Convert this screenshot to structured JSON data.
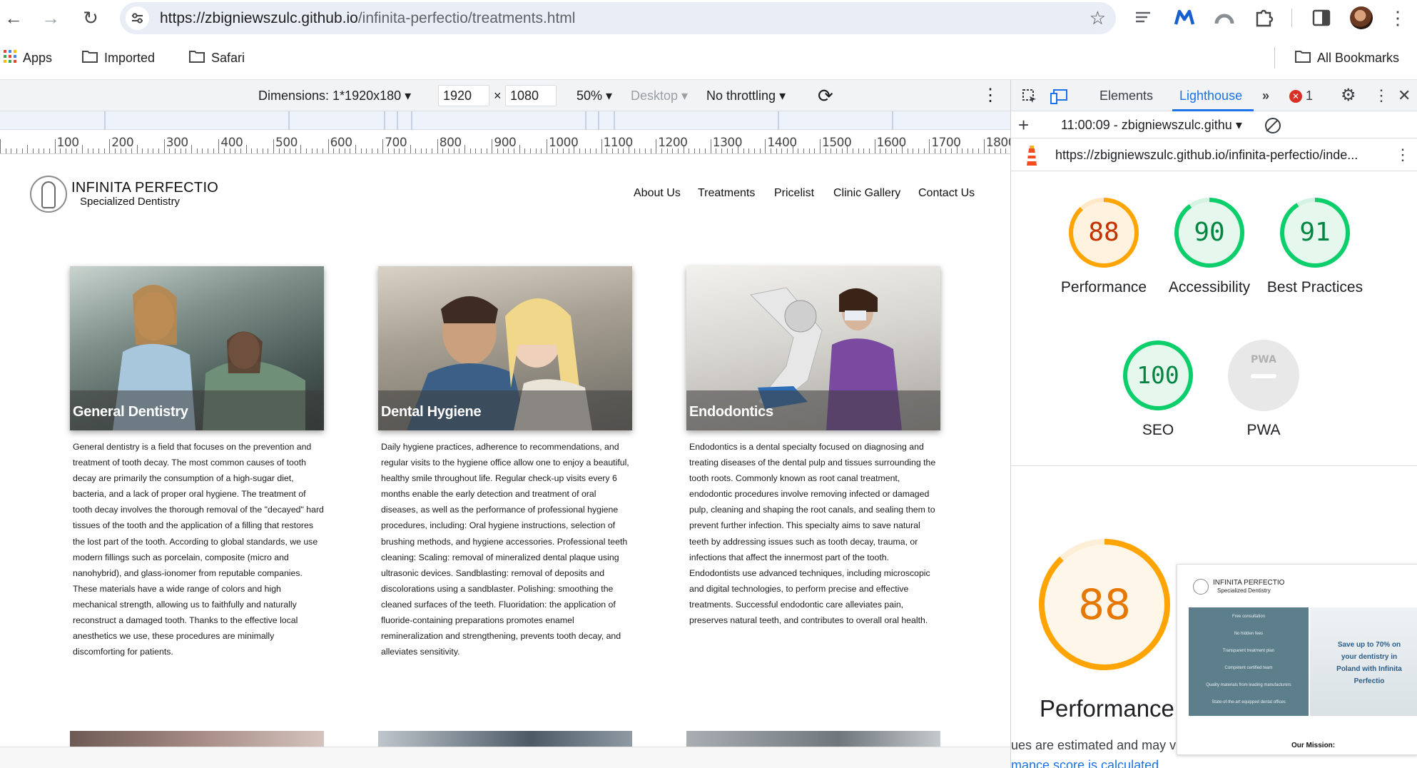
{
  "browser": {
    "url_host": "https://zbigniewszulc.github.io",
    "url_path": "/infinita-perfectio/treatments.html",
    "bookmarks": {
      "apps": "Apps",
      "imported": "Imported",
      "safari": "Safari",
      "all": "All Bookmarks"
    }
  },
  "device_toolbar": {
    "dimensions": "Dimensions: 1*1920x180",
    "width": "1920",
    "times": "×",
    "height": "1080",
    "zoom": "50%",
    "device": "Desktop",
    "throttling": "No throttling"
  },
  "ruler": [
    "100",
    "200",
    "300",
    "400",
    "500",
    "600",
    "700",
    "800",
    "900",
    "1000",
    "1100",
    "1200",
    "1300",
    "1400",
    "1500",
    "1600",
    "1700",
    "1800"
  ],
  "site": {
    "brand": "INFINITA PERFECTIO",
    "tagline": "Specialized Dentistry",
    "nav": [
      "About Us",
      "Treatments",
      "Pricelist",
      "Clinic Gallery",
      "Contact Us"
    ],
    "cards": [
      {
        "title": "General Dentistry",
        "text": "General dentistry is a field that focuses on the prevention and treatment of tooth decay. The most common causes of tooth decay are primarily the consumption of a high-sugar diet, bacteria, and a lack of proper oral hygiene. The treatment of tooth decay involves the thorough removal of the \"decayed\" hard tissues of the tooth and the application of a filling that restores the lost part of the tooth. According to global standards, we use modern fillings such as porcelain, composite (micro and nanohybrid), and glass-ionomer from reputable companies. These materials have a wide range of colors and high mechanical strength, allowing us to faithfully and naturally reconstruct a damaged tooth. Thanks to the effective local anesthetics we use, these procedures are minimally discomforting for patients."
      },
      {
        "title": "Dental Hygiene",
        "text": "Daily hygiene practices, adherence to recommendations, and regular visits to the hygiene office allow one to enjoy a beautiful, healthy smile throughout life. Regular check-up visits every 6 months enable the early detection and treatment of oral diseases, as well as the performance of professional hygiene procedures, including: Oral hygiene instructions, selection of brushing methods, and hygiene accessories. Professional teeth cleaning: Scaling: removal of mineralized dental plaque using ultrasonic devices. Sandblasting: removal of deposits and discolorations using a sandblaster. Polishing: smoothing the cleaned surfaces of the teeth. Fluoridation: the application of fluoride-containing preparations promotes enamel remineralization and strengthening, prevents tooth decay, and alleviates sensitivity."
      },
      {
        "title": "Endodontics",
        "text": "Endodontics is a dental specialty focused on diagnosing and treating diseases of the dental pulp and tissues surrounding the tooth roots. Commonly known as root canal treatment, endodontic procedures involve removing infected or damaged pulp, cleaning and shaping the root canals, and sealing them to prevent further infection. This specialty aims to save natural teeth by addressing issues such as tooth decay, trauma, or infections that affect the innermost part of the tooth. Endodontists use advanced techniques, including microscopic and digital technologies, to perform precise and effective treatments. Successful endodontic care alleviates pain, preserves natural teeth, and contributes to overall oral health."
      }
    ]
  },
  "devtools": {
    "tabs": [
      "Elements",
      "Lighthouse"
    ],
    "error_count": "1",
    "report_time": "11:00:09 - zbigniewszulc.githu",
    "report_url": "https://zbigniewszulc.github.io/infinita-perfectio/inde...",
    "scores": [
      {
        "label": "Performance",
        "value": "88",
        "color": "#ffa400"
      },
      {
        "label": "Accessibility",
        "value": "90",
        "color": "#0cce6b"
      },
      {
        "label": "Best Practices",
        "value": "91",
        "color": "#0cce6b"
      },
      {
        "label": "SEO",
        "value": "100",
        "color": "#0cce6b"
      },
      {
        "label": "PWA",
        "value": "PWA",
        "color": "#9aa0a6"
      }
    ],
    "big_score": "88",
    "big_label": "Performance",
    "note": "ues are estimated and may va",
    "note2": "mance score is calculated",
    "thumbnail": {
      "brand": "INFINITA PERFECTIO",
      "tagline": "Specialized Dentistry",
      "panel_items": [
        "Free consultation",
        "No hidden fees",
        "Transparent treatment plan",
        "Competent certified team",
        "Quality materials from leading manufacturers",
        "State-of-the-art equipped dental offices"
      ],
      "promo": "Save up to 70% on your dentistry in Poland with Infinita Perfectio",
      "mission": "Our Mission:"
    }
  }
}
